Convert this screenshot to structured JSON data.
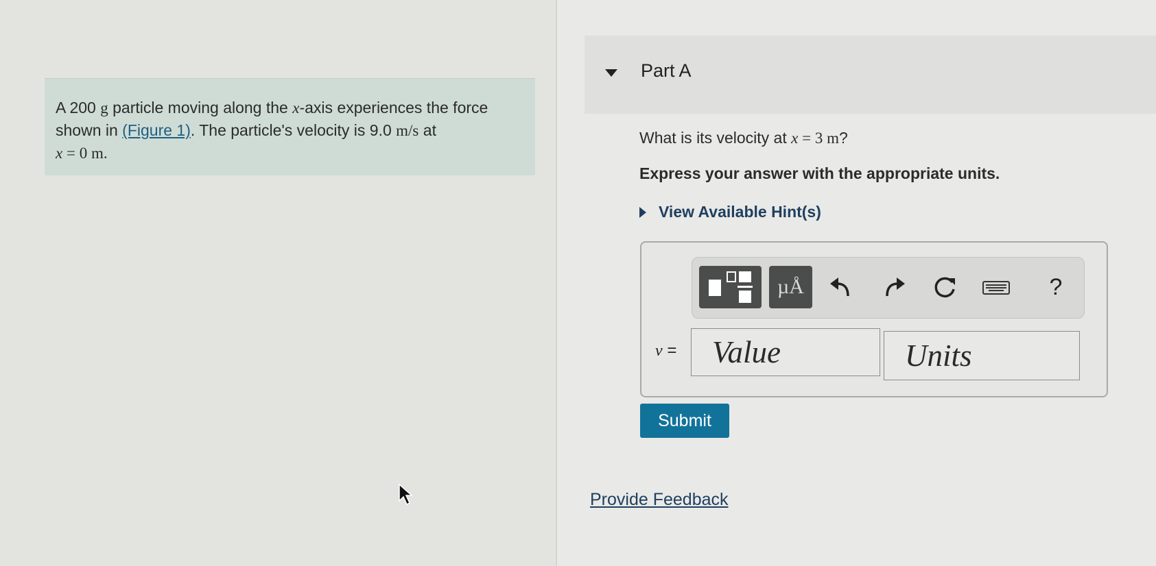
{
  "problem": {
    "mass_value": "200",
    "mass_unit": "g",
    "text_part1": " particle moving along the ",
    "axis_var": "x",
    "text_part2": "-axis experiences the force shown in ",
    "figure_link": "(Figure 1)",
    "text_part3": ". The particle's velocity is ",
    "velocity_value": "9.0",
    "velocity_unit": "m/s",
    "text_part4": " at ",
    "position_var": "x",
    "position_eq": " = 0 ",
    "position_unit": "m."
  },
  "part": {
    "title": "Part A",
    "question_prefix": "What is its velocity at ",
    "question_var": "x",
    "question_eq": " = 3 ",
    "question_unit": "m",
    "question_suffix": "?",
    "instruction": "Express your answer with the appropriate units.",
    "hints_link": "View Available Hint(s)"
  },
  "answer": {
    "var_label": "v",
    "equals": " =",
    "value_placeholder": "Value",
    "units_placeholder": "Units",
    "toolbar": {
      "units_button": "µÅ",
      "help": "?"
    }
  },
  "submit_label": "Submit",
  "feedback_link": "Provide Feedback",
  "icons": [
    "templates-icon",
    "units-icon",
    "undo-icon",
    "redo-icon",
    "reset-icon",
    "keyboard-icon",
    "help-icon",
    "mouse-cursor-icon"
  ],
  "colors": {
    "problem_background": "#cfdcd6",
    "submit_button": "#12739a",
    "link": "#1e5f82",
    "toolbar_dark_button": "#4b4c4c"
  }
}
